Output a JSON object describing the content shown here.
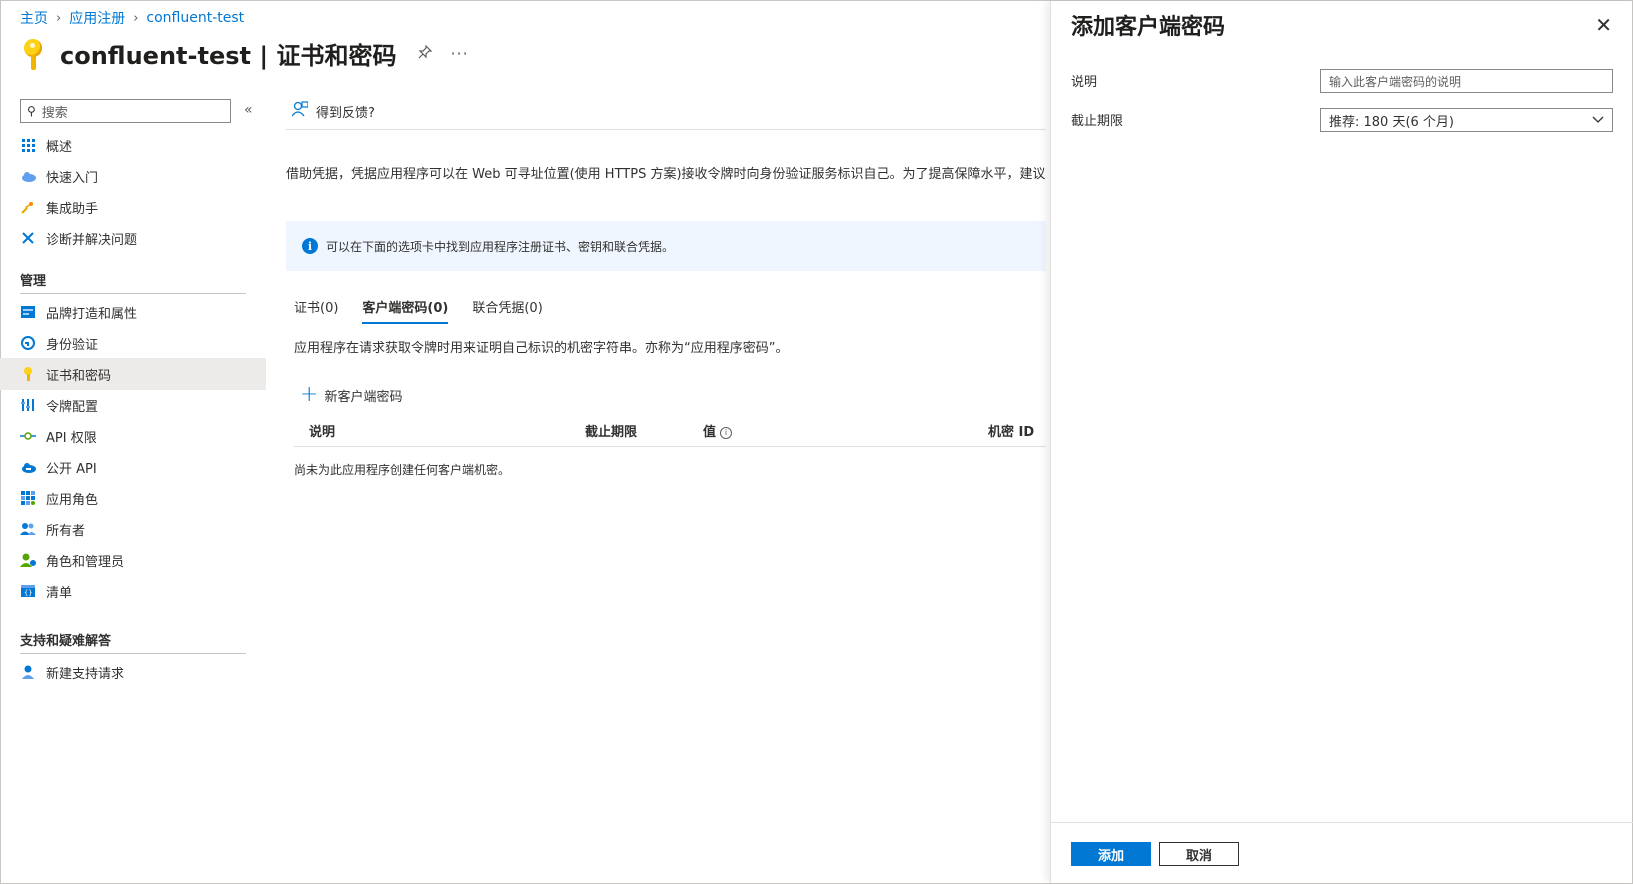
{
  "breadcrumb": {
    "home": "主页",
    "app_reg": "应用注册",
    "app": "confluent-test"
  },
  "page": {
    "title": "confluent-test | 证书和密码",
    "pin_icon": "pin-icon",
    "more_icon": "more-icon"
  },
  "sidebar": {
    "search_placeholder": "搜索",
    "collapse": "«",
    "items_top": [
      {
        "label": "概述",
        "icon": "grid-icon"
      },
      {
        "label": "快速入门",
        "icon": "cloud-icon"
      },
      {
        "label": "集成助手",
        "icon": "rocket-icon"
      },
      {
        "label": "诊断并解决问题",
        "icon": "wrench-icon"
      }
    ],
    "section_manage": "管理",
    "items_manage": [
      {
        "label": "品牌打造和属性",
        "icon": "branding-icon"
      },
      {
        "label": "身份验证",
        "icon": "auth-icon"
      },
      {
        "label": "证书和密码",
        "icon": "key-icon"
      },
      {
        "label": "令牌配置",
        "icon": "token-icon"
      },
      {
        "label": "API 权限",
        "icon": "api-icon"
      },
      {
        "label": "公开 API",
        "icon": "cloud-api-icon"
      },
      {
        "label": "应用角色",
        "icon": "app-roles-icon"
      },
      {
        "label": "所有者",
        "icon": "owners-icon"
      },
      {
        "label": "角色和管理员",
        "icon": "roles-admin-icon"
      },
      {
        "label": "清单",
        "icon": "manifest-icon"
      }
    ],
    "section_support": "支持和疑难解答",
    "items_support": [
      {
        "label": "新建支持请求",
        "icon": "support-icon"
      }
    ]
  },
  "main": {
    "feedback": "得到反馈?",
    "description": "借助凭据，凭据应用程序可以在 Web 可寻址位置(使用 HTTPS 方案)接收令牌时向身份验证服务标识自己。为了提高保障水平，建议使",
    "info": "可以在下面的选项卡中找到应用程序注册证书、密钥和联合凭据。",
    "tabs": [
      "证书(0)",
      "客户端密码(0)",
      "联合凭据(0)"
    ],
    "secret_description": "应用程序在请求获取令牌时用来证明自己标识的机密字符串。亦称为“应用程序密码”。",
    "new_secret": "新客户端密码",
    "table_headers": [
      "说明",
      "截止期限",
      "值",
      "机密 ID"
    ],
    "empty": "尚未为此应用程序创建任何客户端机密。"
  },
  "panel": {
    "title": "添加客户端密码",
    "desc_label": "说明",
    "desc_placeholder": "输入此客户端密码的说明",
    "expires_label": "截止期限",
    "expires_value": "推荐: 180 天(6 个月)",
    "add": "添加",
    "cancel": "取消"
  }
}
